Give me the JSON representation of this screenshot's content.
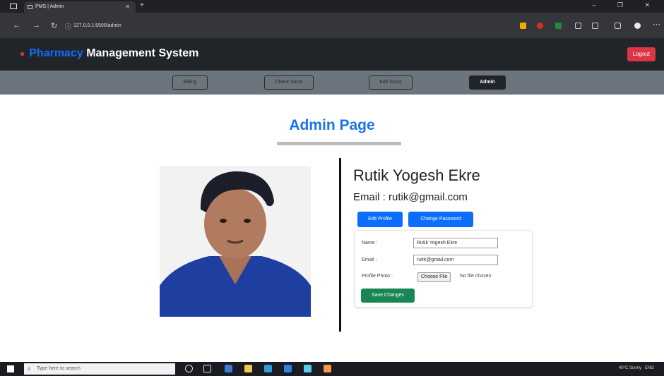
{
  "browser": {
    "tab_title": "PMS | Admin",
    "url": "127.0.0.1:5500/admin",
    "new_tab": "+",
    "window_controls": "– ❐ ✕"
  },
  "app": {
    "brand_accent": "Pharmacy",
    "brand_rest": "Management System",
    "logout_label": "Logout"
  },
  "subnav": {
    "items": [
      "Billing",
      "Check Stock",
      "Edit Stock",
      "Admin"
    ],
    "active": "Admin"
  },
  "page": {
    "title": "Admin Page"
  },
  "profile": {
    "name": "Rutik Yogesh Ekre",
    "email_line": "Email : rutik@gmail.com",
    "edit_profile_label": "Edit Profile",
    "change_password_label": "Change Password"
  },
  "form": {
    "name_label": "Name :",
    "name_value": "Rutik Yogesh Ekre",
    "email_label": "Email :",
    "email_value": "rutik@gmail.com",
    "photo_label": "Profile Photo :",
    "choose_file_label": "Choose File",
    "file_status": "No file chosen",
    "save_label": "Save Changes"
  },
  "taskbar": {
    "search_placeholder": "Type here to search",
    "weather": "40°C Sunny",
    "tray_text": "ENG"
  },
  "colors": {
    "brand_accent": "#0d6efd",
    "title": "#1a73e8",
    "save_button": "#198754",
    "logout": "#dc3545",
    "navbar": "#212529",
    "subnav": "#6c757d"
  }
}
